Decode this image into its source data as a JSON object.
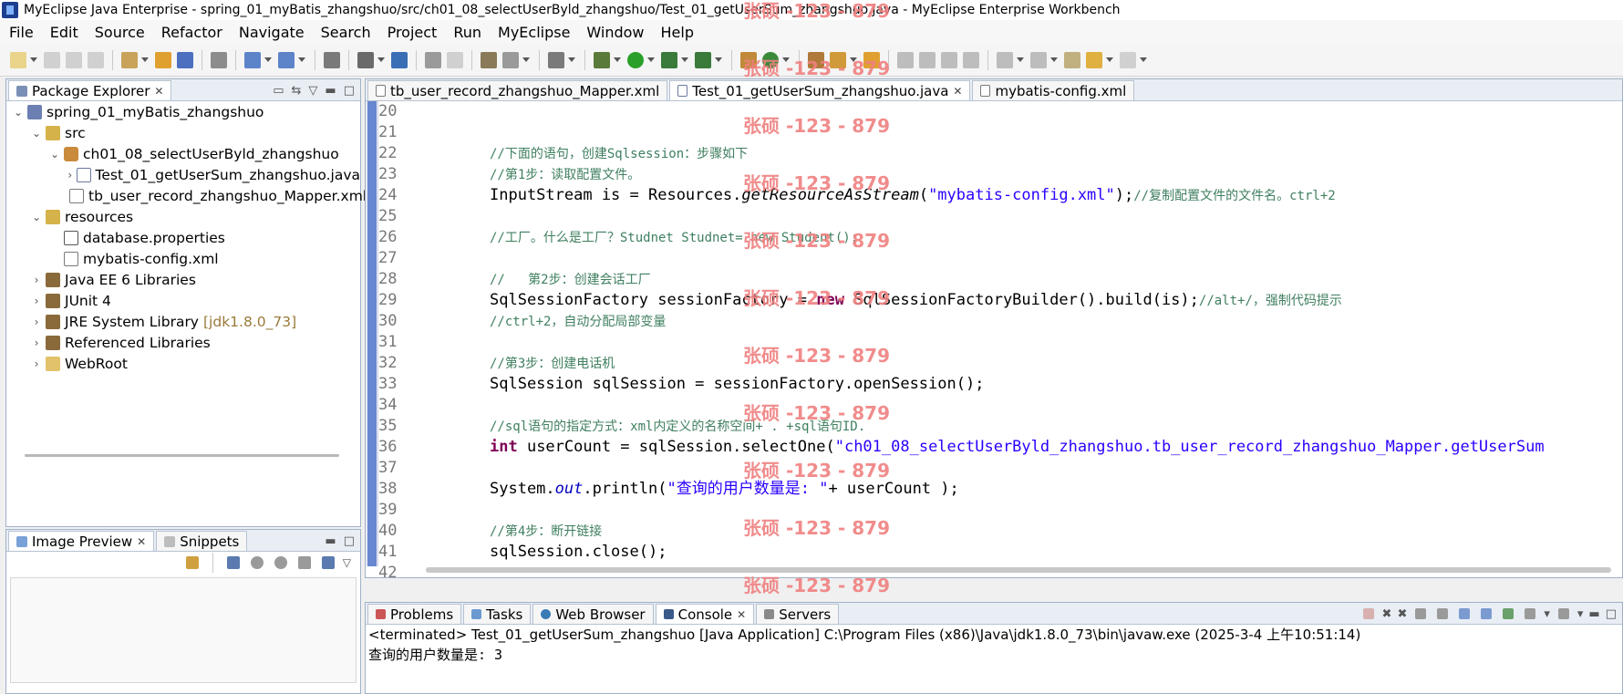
{
  "window": {
    "title": "MyEclipse Java Enterprise - spring_01_myBatis_zhangshuo/src/ch01_08_selectUserByld_zhangshuo/Test_01_getUserSum_zhangshuo.java - MyEclipse Enterprise Workbench"
  },
  "menu": [
    "File",
    "Edit",
    "Source",
    "Refactor",
    "Navigate",
    "Search",
    "Project",
    "Run",
    "MyEclipse",
    "Window",
    "Help"
  ],
  "package_explorer": {
    "title": "Package Explorer",
    "tree": [
      {
        "label": "spring_01_myBatis_zhangshuo",
        "depth": 0,
        "icon": "project-icon",
        "twisty": "expanded"
      },
      {
        "label": "src",
        "depth": 1,
        "icon": "source-folder-icon",
        "twisty": "expanded"
      },
      {
        "label": "ch01_08_selectUserByld_zhangshuo",
        "depth": 2,
        "icon": "package-icon",
        "twisty": "expanded"
      },
      {
        "label": "Test_01_getUserSum_zhangshuo.java",
        "depth": 3,
        "icon": "java-file-icon",
        "twisty": "collapsed"
      },
      {
        "label": "tb_user_record_zhangshuo_Mapper.xml",
        "depth": 3,
        "icon": "xml-file-icon",
        "twisty": "none"
      },
      {
        "label": "resources",
        "depth": 1,
        "icon": "source-folder-icon",
        "twisty": "expanded"
      },
      {
        "label": "database.properties",
        "depth": 2,
        "icon": "properties-file-icon",
        "twisty": "none"
      },
      {
        "label": "mybatis-config.xml",
        "depth": 2,
        "icon": "xml-file-icon",
        "twisty": "none"
      },
      {
        "label": "Java EE 6 Libraries",
        "depth": 1,
        "icon": "library-icon",
        "twisty": "collapsed"
      },
      {
        "label": "JUnit 4",
        "depth": 1,
        "icon": "library-icon",
        "twisty": "collapsed"
      },
      {
        "label": "JRE System Library",
        "suffix": "[jdk1.8.0_73]",
        "depth": 1,
        "icon": "library-icon",
        "twisty": "collapsed"
      },
      {
        "label": "Referenced Libraries",
        "depth": 1,
        "icon": "library-icon",
        "twisty": "collapsed"
      },
      {
        "label": "WebRoot",
        "depth": 1,
        "icon": "folder-icon",
        "twisty": "collapsed"
      }
    ]
  },
  "bottom_left": {
    "tabs": [
      "Image Preview",
      "Snippets"
    ]
  },
  "editor": {
    "tabs": [
      "tb_user_record_zhangshuo_Mapper.xml",
      "Test_01_getUserSum_zhangshuo.java",
      "mybatis-config.xml"
    ],
    "active_tab": "Test_01_getUserSum_zhangshuo.java",
    "line_numbers": [
      "20",
      "21",
      "22",
      "23",
      "24",
      "25",
      "26",
      "27",
      "28",
      "29",
      "30",
      "31",
      "32",
      "33",
      "34",
      "35",
      "36",
      "37",
      "38",
      "39",
      "40",
      "41",
      "42"
    ],
    "code": {
      "l22": "//下面的语句，创建Sqlsession：步骤如下",
      "l23": "//第1步：读取配置文件。",
      "l24a": "InputStream is = Resources.",
      "l24b": "getResourceAsStream",
      "l24c": "(",
      "l24d": "\"mybatis-config.xml\"",
      "l24e": ");",
      "l24f": "//复制配置文件的文件名。ctrl+2",
      "l26": "//工厂。什么是工厂？Studnet Studnet= new Student();",
      "l28": "//   第2步：创建会话工厂",
      "l29a": "SqlSessionFactory sessionFactory = ",
      "l29b": "new",
      "l29c": " SqlSessionFactoryBuilder().build(is);",
      "l29d": "//alt+/，强制代码提示",
      "l30": "//ctrl+2，自动分配局部变量",
      "l32": "//第3步：创建电话机",
      "l33": "SqlSession sqlSession = sessionFactory.openSession();",
      "l35": "//sql语句的指定方式：xml内定义的名称空间+ . +sql语句ID.",
      "l36a": "int",
      "l36b": " userCount = sqlSession.selectOne(",
      "l36c": "\"ch01_08_selectUserByld_zhangshuo.tb_user_record_zhangshuo_Mapper.getUserSum",
      "l38a": "System.",
      "l38b": "out",
      "l38c": ".println(",
      "l38d": "\"查询的用户数量是: \"",
      "l38e": "+ userCount );",
      "l40": "//第4步：断开链接",
      "l41": "sqlSession.close();"
    }
  },
  "bottom_panel": {
    "tabs": [
      "Problems",
      "Tasks",
      "Web Browser",
      "Console",
      "Servers"
    ],
    "active_tab": "Console",
    "status_line": "<terminated> Test_01_getUserSum_zhangshuo [Java Application] C:\\Program Files (x86)\\Java\\jdk1.8.0_73\\bin\\javaw.exe (2025-3-4 上午10:51:14)",
    "output": "查询的用户数量是:  3"
  },
  "watermark": "张硕 -123 - 879",
  "colors": {
    "comment": "#3f7f5f",
    "keyword": "#7f0055",
    "string": "#2a00ff",
    "watermark": "#f08080"
  }
}
